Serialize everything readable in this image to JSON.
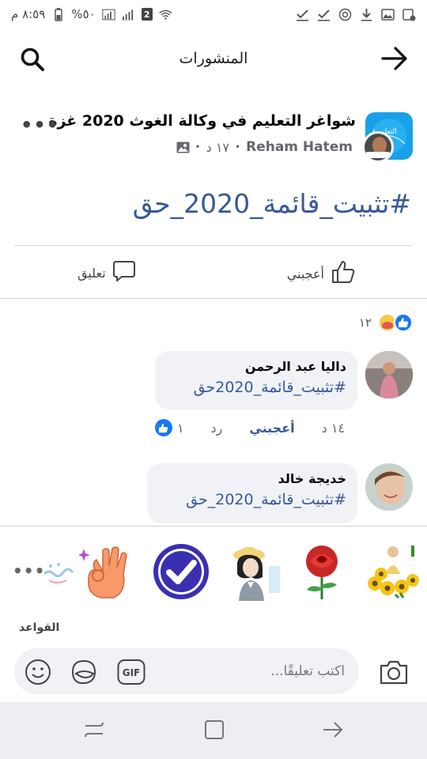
{
  "status_bar": {
    "time": "٨:٥٩ م",
    "battery": "%٥٠",
    "sim_badge": "2"
  },
  "header": {
    "title": "المنشورات"
  },
  "post": {
    "group_name": "شواغر التعليم في وكالة الغوث 2020 غزة",
    "author": "Reham Hatem",
    "time": "١٧ د",
    "hashtag": "#تثبيت_قائمة_2020_حق",
    "group_avatar_text": "التعليم فـ",
    "like_label": "أعجبني",
    "comment_label": "تعليق",
    "more": "•••"
  },
  "reactions": {
    "count": "١٢"
  },
  "comments": [
    {
      "name": "داليا عبد الرحمن",
      "text": "#تثبيت_قائمة_2020حق",
      "time": "١٤ د",
      "like_label": "أعجبني",
      "reply_label": "رد",
      "likes": "١"
    },
    {
      "name": "خديجة خالد",
      "text": "#تثبيت_قائمة_2020_حق"
    }
  ],
  "stickers": {
    "more": "•••",
    "items": [
      "girl-in-sunflowers-sticker",
      "red-rose-sticker",
      "girl-with-hat-sticker",
      "check-mark-sticker",
      "ok-hand-sticker",
      "greeting-text-sticker"
    ]
  },
  "rules_label": "القواعد",
  "composer": {
    "placeholder": "اكتب تعليقًا..."
  },
  "colors": {
    "link": "#385898",
    "facebook_blue": "#1877f2",
    "bubble": "#f0f2f5",
    "check_sticker": "#3a2fb0"
  }
}
